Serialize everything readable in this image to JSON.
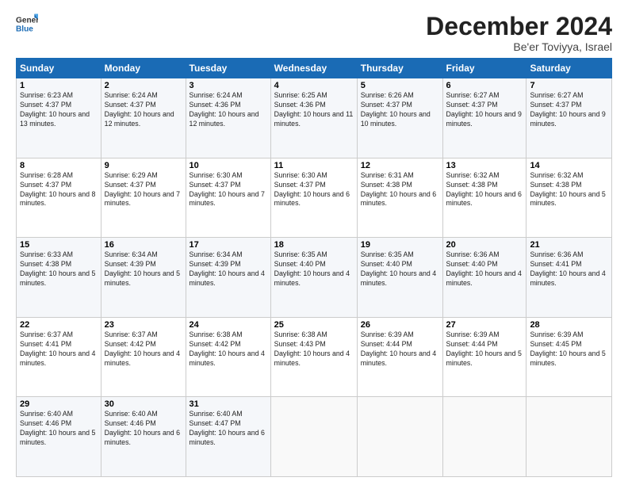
{
  "logo": {
    "line1": "General",
    "line2": "Blue"
  },
  "title": "December 2024",
  "location": "Be'er Toviyya, Israel",
  "days_header": [
    "Sunday",
    "Monday",
    "Tuesday",
    "Wednesday",
    "Thursday",
    "Friday",
    "Saturday"
  ],
  "weeks": [
    [
      {
        "num": "1",
        "sunrise": "6:23 AM",
        "sunset": "4:37 PM",
        "daylight": "10 hours and 13 minutes."
      },
      {
        "num": "2",
        "sunrise": "6:24 AM",
        "sunset": "4:37 PM",
        "daylight": "10 hours and 12 minutes."
      },
      {
        "num": "3",
        "sunrise": "6:24 AM",
        "sunset": "4:36 PM",
        "daylight": "10 hours and 12 minutes."
      },
      {
        "num": "4",
        "sunrise": "6:25 AM",
        "sunset": "4:36 PM",
        "daylight": "10 hours and 11 minutes."
      },
      {
        "num": "5",
        "sunrise": "6:26 AM",
        "sunset": "4:37 PM",
        "daylight": "10 hours and 10 minutes."
      },
      {
        "num": "6",
        "sunrise": "6:27 AM",
        "sunset": "4:37 PM",
        "daylight": "10 hours and 9 minutes."
      },
      {
        "num": "7",
        "sunrise": "6:27 AM",
        "sunset": "4:37 PM",
        "daylight": "10 hours and 9 minutes."
      }
    ],
    [
      {
        "num": "8",
        "sunrise": "6:28 AM",
        "sunset": "4:37 PM",
        "daylight": "10 hours and 8 minutes."
      },
      {
        "num": "9",
        "sunrise": "6:29 AM",
        "sunset": "4:37 PM",
        "daylight": "10 hours and 7 minutes."
      },
      {
        "num": "10",
        "sunrise": "6:30 AM",
        "sunset": "4:37 PM",
        "daylight": "10 hours and 7 minutes."
      },
      {
        "num": "11",
        "sunrise": "6:30 AM",
        "sunset": "4:37 PM",
        "daylight": "10 hours and 6 minutes."
      },
      {
        "num": "12",
        "sunrise": "6:31 AM",
        "sunset": "4:38 PM",
        "daylight": "10 hours and 6 minutes."
      },
      {
        "num": "13",
        "sunrise": "6:32 AM",
        "sunset": "4:38 PM",
        "daylight": "10 hours and 6 minutes."
      },
      {
        "num": "14",
        "sunrise": "6:32 AM",
        "sunset": "4:38 PM",
        "daylight": "10 hours and 5 minutes."
      }
    ],
    [
      {
        "num": "15",
        "sunrise": "6:33 AM",
        "sunset": "4:38 PM",
        "daylight": "10 hours and 5 minutes."
      },
      {
        "num": "16",
        "sunrise": "6:34 AM",
        "sunset": "4:39 PM",
        "daylight": "10 hours and 5 minutes."
      },
      {
        "num": "17",
        "sunrise": "6:34 AM",
        "sunset": "4:39 PM",
        "daylight": "10 hours and 4 minutes."
      },
      {
        "num": "18",
        "sunrise": "6:35 AM",
        "sunset": "4:40 PM",
        "daylight": "10 hours and 4 minutes."
      },
      {
        "num": "19",
        "sunrise": "6:35 AM",
        "sunset": "4:40 PM",
        "daylight": "10 hours and 4 minutes."
      },
      {
        "num": "20",
        "sunrise": "6:36 AM",
        "sunset": "4:40 PM",
        "daylight": "10 hours and 4 minutes."
      },
      {
        "num": "21",
        "sunrise": "6:36 AM",
        "sunset": "4:41 PM",
        "daylight": "10 hours and 4 minutes."
      }
    ],
    [
      {
        "num": "22",
        "sunrise": "6:37 AM",
        "sunset": "4:41 PM",
        "daylight": "10 hours and 4 minutes."
      },
      {
        "num": "23",
        "sunrise": "6:37 AM",
        "sunset": "4:42 PM",
        "daylight": "10 hours and 4 minutes."
      },
      {
        "num": "24",
        "sunrise": "6:38 AM",
        "sunset": "4:42 PM",
        "daylight": "10 hours and 4 minutes."
      },
      {
        "num": "25",
        "sunrise": "6:38 AM",
        "sunset": "4:43 PM",
        "daylight": "10 hours and 4 minutes."
      },
      {
        "num": "26",
        "sunrise": "6:39 AM",
        "sunset": "4:44 PM",
        "daylight": "10 hours and 4 minutes."
      },
      {
        "num": "27",
        "sunrise": "6:39 AM",
        "sunset": "4:44 PM",
        "daylight": "10 hours and 5 minutes."
      },
      {
        "num": "28",
        "sunrise": "6:39 AM",
        "sunset": "4:45 PM",
        "daylight": "10 hours and 5 minutes."
      }
    ],
    [
      {
        "num": "29",
        "sunrise": "6:40 AM",
        "sunset": "4:46 PM",
        "daylight": "10 hours and 5 minutes."
      },
      {
        "num": "30",
        "sunrise": "6:40 AM",
        "sunset": "4:46 PM",
        "daylight": "10 hours and 6 minutes."
      },
      {
        "num": "31",
        "sunrise": "6:40 AM",
        "sunset": "4:47 PM",
        "daylight": "10 hours and 6 minutes."
      },
      null,
      null,
      null,
      null
    ]
  ]
}
